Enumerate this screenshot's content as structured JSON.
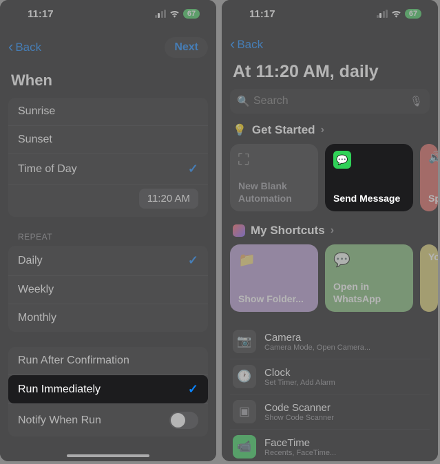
{
  "status": {
    "time": "11:17",
    "battery": "67"
  },
  "left": {
    "back": "Back",
    "next": "Next",
    "heading": "When",
    "when_options": {
      "sunrise": "Sunrise",
      "sunset": "Sunset",
      "tod": "Time of Day"
    },
    "time_value": "11:20 AM",
    "repeat_label": "REPEAT",
    "repeat": {
      "daily": "Daily",
      "weekly": "Weekly",
      "monthly": "Monthly"
    },
    "run": {
      "after": "Run After Confirmation",
      "immediately": "Run Immediately",
      "notify": "Notify When Run"
    }
  },
  "right": {
    "back": "Back",
    "title": "At 11:20 AM, daily",
    "search_placeholder": "Search",
    "get_started": "Get Started",
    "cards": {
      "blank": "New Blank Automation",
      "send_message": "Send Message",
      "speak_partial": "Sp"
    },
    "my_shortcuts": "My Shortcuts",
    "sc_cards": {
      "folder": "Show Folder...",
      "whatsapp": "Open in WhatsApp",
      "y_partial": "Yo"
    },
    "apps": {
      "camera": {
        "name": "Camera",
        "sub": "Camera Mode, Open Camera..."
      },
      "clock": {
        "name": "Clock",
        "sub": "Set Timer, Add Alarm"
      },
      "scanner": {
        "name": "Code Scanner",
        "sub": "Show Code Scanner"
      },
      "facetime": {
        "name": "FaceTime",
        "sub": "Recents, FaceTime..."
      }
    }
  }
}
